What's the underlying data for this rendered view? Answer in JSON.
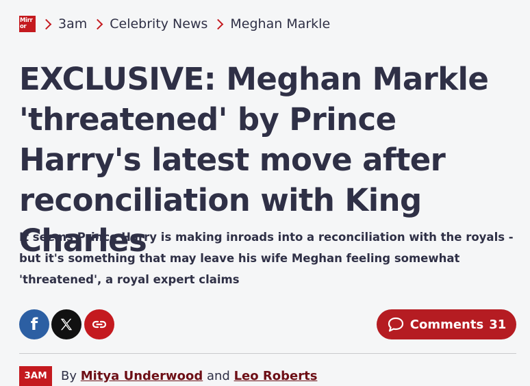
{
  "breadcrumb": {
    "logo_line1": "Mirr",
    "logo_line2": "or",
    "items": [
      "3am",
      "Celebrity News",
      "Meghan Markle"
    ]
  },
  "article": {
    "headline": "EXCLUSIVE: Meghan Markle 'threatened' by Prince Harry's latest move after reconciliation with King Charles",
    "standfirst": "It seems Prince Harry is making inroads into a reconciliation with the royals - but it's something that may leave his wife Meghan feeling somewhat 'threatened', a royal expert claims"
  },
  "share": {
    "facebook_icon": "facebook-icon",
    "x_icon": "x-icon",
    "link_icon": "link-icon",
    "facebook_glyph": "f"
  },
  "comments": {
    "label": "Comments",
    "count": "31",
    "icon": "speech-bubble-icon"
  },
  "byline": {
    "section_badge": "3AM",
    "prefix": "By",
    "author1": "Mitya Underwood",
    "conjunction": "and",
    "author2": "Leo Roberts"
  },
  "colors": {
    "brand_red": "#c41a1f",
    "comments_red": "#b51c22",
    "facebook_blue": "#2c5fa3",
    "text": "#2f3046",
    "author_link": "#6d0f16"
  }
}
